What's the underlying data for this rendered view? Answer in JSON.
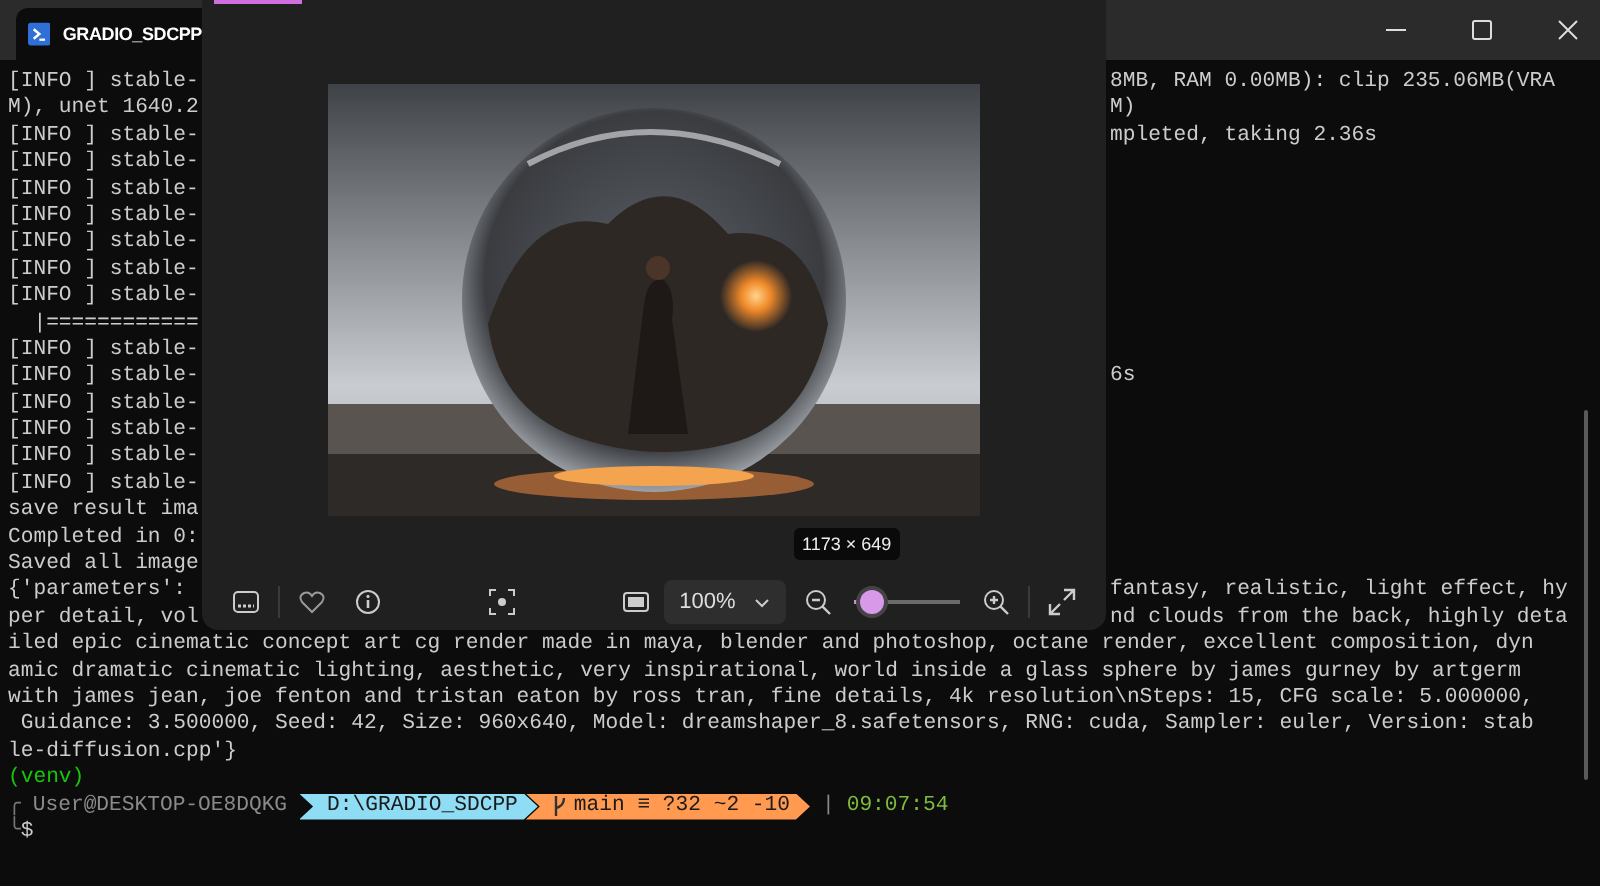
{
  "tab": {
    "title": "GRADIO_SDCPP"
  },
  "terminal": {
    "lines": [
      {
        "kind": "split",
        "left": "[INFO ] stable-",
        "right": "8MB, RAM 0.00MB): clip 235.06MB(VRA"
      },
      {
        "kind": "split",
        "left": "M), unet 1640.2",
        "right": "M)"
      },
      {
        "kind": "split",
        "left": "[INFO ] stable-",
        "right": "mpleted, taking 2.36s"
      },
      {
        "kind": "split",
        "left": "[INFO ] stable-"
      },
      {
        "kind": "split",
        "left": "[INFO ] stable-"
      },
      {
        "kind": "split",
        "left": "[INFO ] stable-"
      },
      {
        "kind": "split",
        "left": "[INFO ] stable-"
      },
      {
        "kind": "split",
        "left": "[INFO ] stable-"
      },
      {
        "kind": "split",
        "left": "[INFO ] stable-"
      },
      {
        "kind": "split",
        "left": "  |============"
      },
      {
        "kind": "split",
        "left": "[INFO ] stable-"
      },
      {
        "kind": "split",
        "left": "[INFO ] stable-",
        "right": "6s"
      },
      {
        "kind": "split",
        "left": "[INFO ] stable-"
      },
      {
        "kind": "split",
        "left": "[INFO ] stable-"
      },
      {
        "kind": "split",
        "left": "[INFO ] stable-"
      },
      {
        "kind": "split",
        "left": "[INFO ] stable-"
      },
      {
        "kind": "split",
        "left": "save result ima"
      },
      {
        "kind": "split",
        "left": "Completed in 0:"
      },
      {
        "kind": "split",
        "left": "Saved all image"
      },
      {
        "kind": "split",
        "left": "{'parameters':",
        "right": "fantasy, realistic, light effect, hy"
      },
      {
        "kind": "split",
        "left": "per detail, vol",
        "right": "nd clouds from the back, highly deta"
      },
      {
        "kind": "full",
        "text": "iled epic cinematic concept art cg render made in maya, blender and photoshop, octane render, excellent composition, dyn"
      },
      {
        "kind": "full",
        "text": "amic dramatic cinematic lighting, aesthetic, very inspirational, world inside a glass sphere by james gurney by artgerm"
      },
      {
        "kind": "full",
        "text": "with james jean, joe fenton and tristan eaton by ross tran, fine details, 4k resolution\\nSteps: 15, CFG scale: 5.000000,"
      },
      {
        "kind": "full",
        "text": " Guidance: 3.500000, Seed: 42, Size: 960x640, Model: dreamshaper_8.safetensors, RNG: cuda, Sampler: euler, Version: stab"
      },
      {
        "kind": "full",
        "text": "le-diffusion.cpp'}"
      }
    ],
    "prompt": {
      "venv": "(venv)",
      "corner_top": "╭",
      "user": "User@DESKTOP-OE8DQKG",
      "path": "D:\\GRADIO_SDCPP",
      "git": "main ≡ ?32 ~2 -10",
      "separator": "|",
      "time": "09:07:54",
      "corner_bottom": "╰",
      "symbol": "$"
    }
  },
  "viewer": {
    "size_tooltip": "1173 × 649",
    "zoom": "100%",
    "zoom_slider": {
      "level": 0.17
    }
  }
}
